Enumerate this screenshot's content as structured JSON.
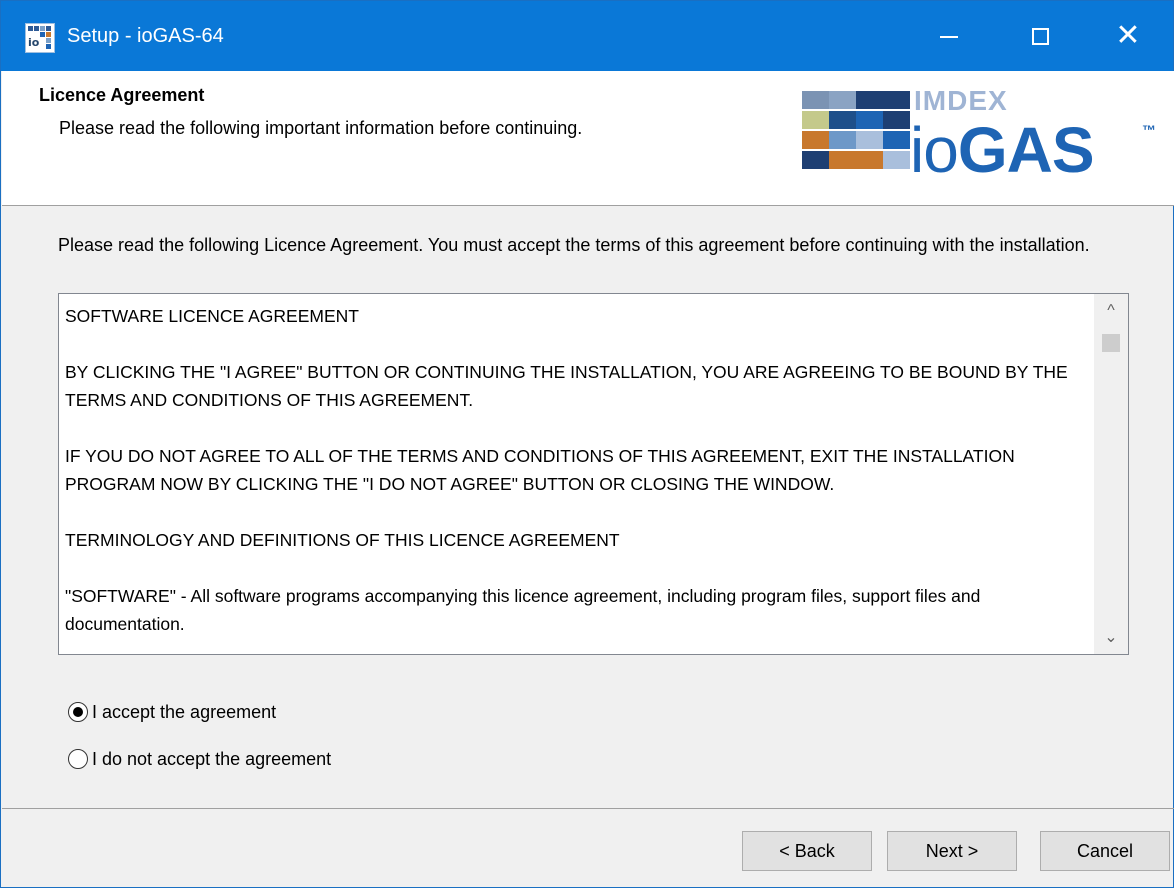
{
  "window": {
    "title": "Setup - ioGAS-64",
    "icon": "iogas-app-icon",
    "icon_text": "io",
    "controls": [
      "minimize-icon",
      "maximize-icon",
      "close-icon"
    ],
    "close_glyph": "✕"
  },
  "header": {
    "title": "Licence Agreement",
    "subtitle": "Please read the following important information before continuing.",
    "logo": {
      "company": "IMDEX",
      "product_io": "io",
      "product_gas": "GAS",
      "trademark": "™"
    }
  },
  "intro": "Please read the following Licence Agreement. You must accept the terms of this agreement before continuing with the installation.",
  "licence_text": {
    "p1": "SOFTWARE LICENCE AGREEMENT",
    "p2": "BY CLICKING THE \"I AGREE\" BUTTON OR CONTINUING THE INSTALLATION, YOU ARE AGREEING TO BE BOUND BY THE TERMS AND CONDITIONS OF THIS AGREEMENT.",
    "p3": "IF YOU DO NOT AGREE TO ALL OF THE TERMS AND CONDITIONS OF THIS AGREEMENT, EXIT THE INSTALLATION PROGRAM NOW BY CLICKING THE \"I DO NOT AGREE\" BUTTON OR CLOSING THE WINDOW.",
    "p4": "TERMINOLOGY AND DEFINITIONS OF THIS LICENCE AGREEMENT",
    "p5": "\"SOFTWARE\" - All software programs accompanying this licence agreement, including program files, support files and documentation."
  },
  "scrollbar": {
    "up": "^",
    "down": "⌄"
  },
  "options": {
    "accept": {
      "label": "I accept the agreement",
      "selected": true
    },
    "decline": {
      "label": "I do not accept the agreement",
      "selected": false
    }
  },
  "buttons": {
    "back": "< Back",
    "next": "Next >",
    "cancel": "Cancel"
  },
  "colors": {
    "titlebar": "#0a78d7",
    "logo_blue": "#1e64b4",
    "logo_orange": "#c8782d"
  }
}
